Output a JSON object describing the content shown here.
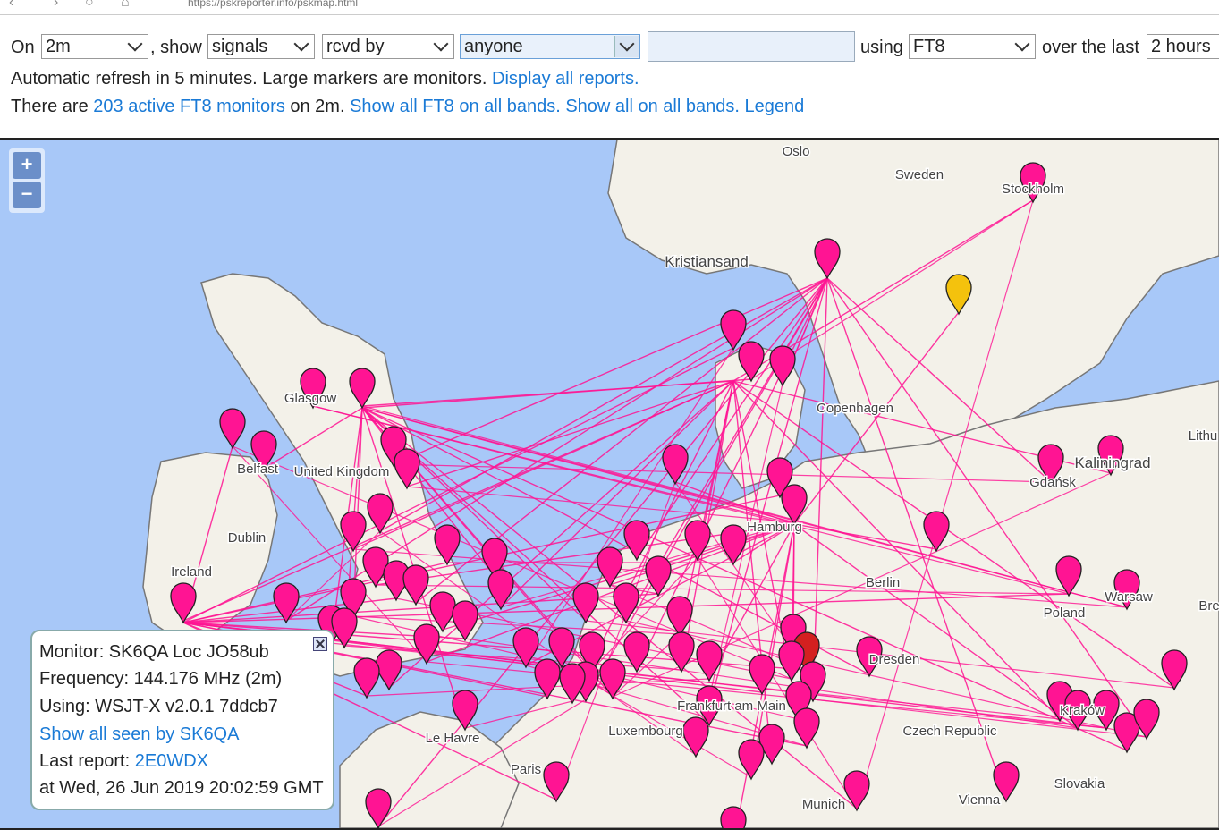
{
  "browser": {
    "url": "https://pskreporter.info/pskmap.html"
  },
  "controls": {
    "on_label": "On",
    "band": "2m",
    "show_label": ", show",
    "mode_select": "signals",
    "direction_select": "rcvd by",
    "who_select": "anyone",
    "callsign_placeholder": "",
    "using_label": "using",
    "protocol_select": "FT8",
    "over_label": "over the last",
    "period_select": "2 hours"
  },
  "status": {
    "refresh_text": "Automatic refresh in 5 minutes. Large markers are monitors.",
    "display_all_link": "Display all reports.",
    "there_are": "There are",
    "monitors_link": "203 active FT8 monitors",
    "on_band_text": "on 2m.",
    "show_ft8_link": "Show all FT8 on all bands.",
    "show_all_link": "Show all on all bands.",
    "legend_link": "Legend"
  },
  "map": {
    "zoom_in": "+",
    "zoom_out": "−",
    "cities": [
      "Oslo",
      "Sweden",
      "Stockholm",
      "Kristiansand",
      "Copenhagen",
      "Lithu",
      "Kaliningrad",
      "Gdańsk",
      "Glasgow",
      "Belfast",
      "United Kingdom",
      "Dublin",
      "Ireland",
      "Hamburg",
      "Berlin",
      "Poland",
      "Warsaw",
      "Bre",
      "Dresden",
      "Czech Republic",
      "Frankfurt am Main",
      "Luxembourg",
      "Le Havre",
      "Paris",
      "Munich",
      "Vienna",
      "Slovakia",
      "Kraków"
    ],
    "colors": {
      "water": "#a8c8f8",
      "land": "#f4f2ec",
      "marker": "#ff1493",
      "path": "#ff1493"
    }
  },
  "popup": {
    "monitor": "Monitor: SK6QA Loc JO58ub",
    "frequency": "Frequency: 144.176 MHz (2m)",
    "using": "Using: WSJT-X v2.0.1 7ddcb7",
    "show_all_seen": "Show all seen by SK6QA",
    "last_report_label": "Last report:",
    "last_report_call": "2E0WDX",
    "at_time": "at Wed, 26 Jun 2019 20:02:59 GMT"
  }
}
